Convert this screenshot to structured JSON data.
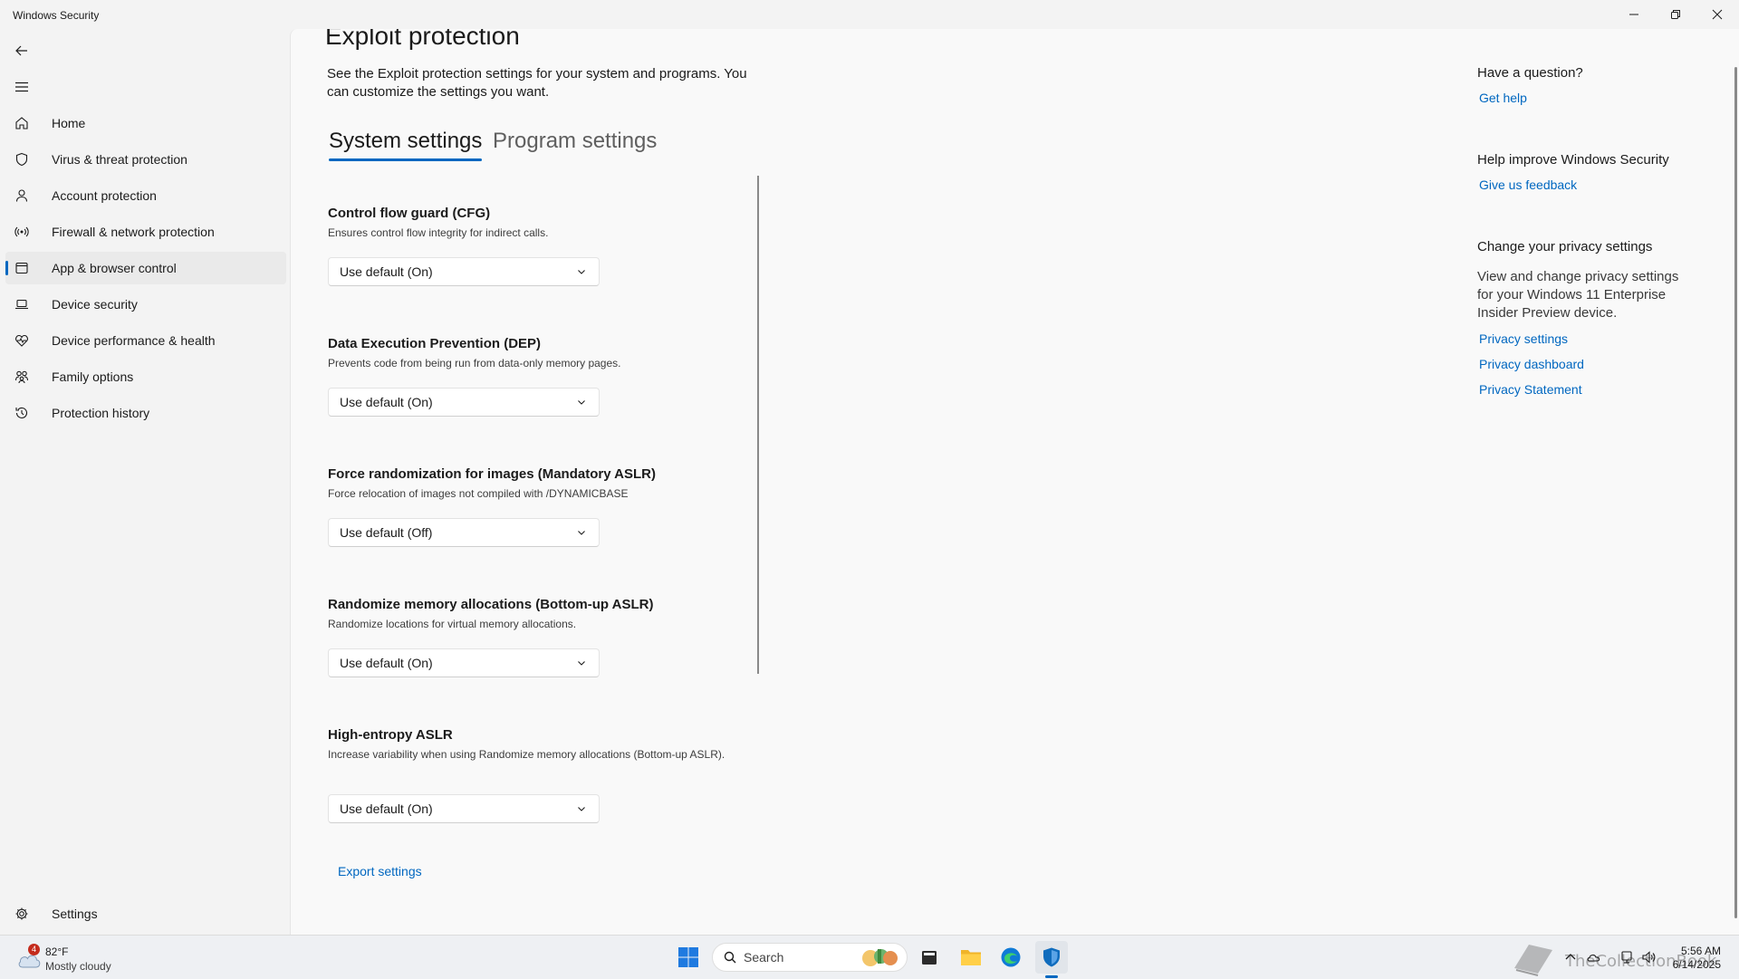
{
  "window": {
    "title": "Windows Security"
  },
  "sidebar": {
    "items": [
      {
        "label": "Home",
        "icon": "home-icon"
      },
      {
        "label": "Virus & threat protection",
        "icon": "shield-icon"
      },
      {
        "label": "Account protection",
        "icon": "person-icon"
      },
      {
        "label": "Firewall & network protection",
        "icon": "antenna-icon"
      },
      {
        "label": "App & browser control",
        "icon": "app-window-icon",
        "selected": true
      },
      {
        "label": "Device security",
        "icon": "laptop-icon"
      },
      {
        "label": "Device performance & health",
        "icon": "heart-pulse-icon"
      },
      {
        "label": "Family options",
        "icon": "family-icon"
      },
      {
        "label": "Protection history",
        "icon": "history-icon"
      }
    ],
    "settings_label": "Settings"
  },
  "main": {
    "title": "Exploit protection",
    "description": "See the Exploit protection settings for your system and programs.  You can customize the settings you want.",
    "tabs": [
      {
        "label": "System settings",
        "active": true
      },
      {
        "label": "Program settings",
        "active": false
      }
    ],
    "settings": [
      {
        "title": "Control flow guard (CFG)",
        "description": "Ensures control flow integrity for indirect calls.",
        "value": "Use default (On)"
      },
      {
        "title": "Data Execution Prevention (DEP)",
        "description": "Prevents code from being run from data-only memory pages.",
        "value": "Use default (On)"
      },
      {
        "title": "Force randomization for images (Mandatory ASLR)",
        "description": "Force relocation of images not compiled with /DYNAMICBASE",
        "value": "Use default (Off)"
      },
      {
        "title": "Randomize memory allocations (Bottom-up ASLR)",
        "description": "Randomize locations for virtual memory allocations.",
        "value": "Use default (On)"
      },
      {
        "title": "High-entropy ASLR",
        "description": "Increase variability when using Randomize memory allocations (Bottom-up ASLR).",
        "value": "Use default (On)"
      }
    ],
    "export_label": "Export settings"
  },
  "right_panel": {
    "question_heading": "Have a question?",
    "get_help": "Get help",
    "improve_heading": "Help improve Windows Security",
    "feedback": "Give us feedback",
    "privacy_heading": "Change your privacy settings",
    "privacy_text": "View and change privacy settings for your Windows 11 Enterprise Insider Preview device.",
    "privacy_settings": "Privacy settings",
    "privacy_dashboard": "Privacy dashboard",
    "privacy_statement": "Privacy Statement"
  },
  "taskbar": {
    "weather_badge": "4",
    "weather_temp": "82°F",
    "weather_condition": "Mostly cloudy",
    "search_label": "Search",
    "watermark": "TheCollectionBook",
    "time": "5:56 AM",
    "date": "6/14/2025"
  },
  "colors": {
    "accent": "#0067c0",
    "content_bg": "#f9f9f9",
    "sidebar_bg": "#f3f3f3"
  }
}
